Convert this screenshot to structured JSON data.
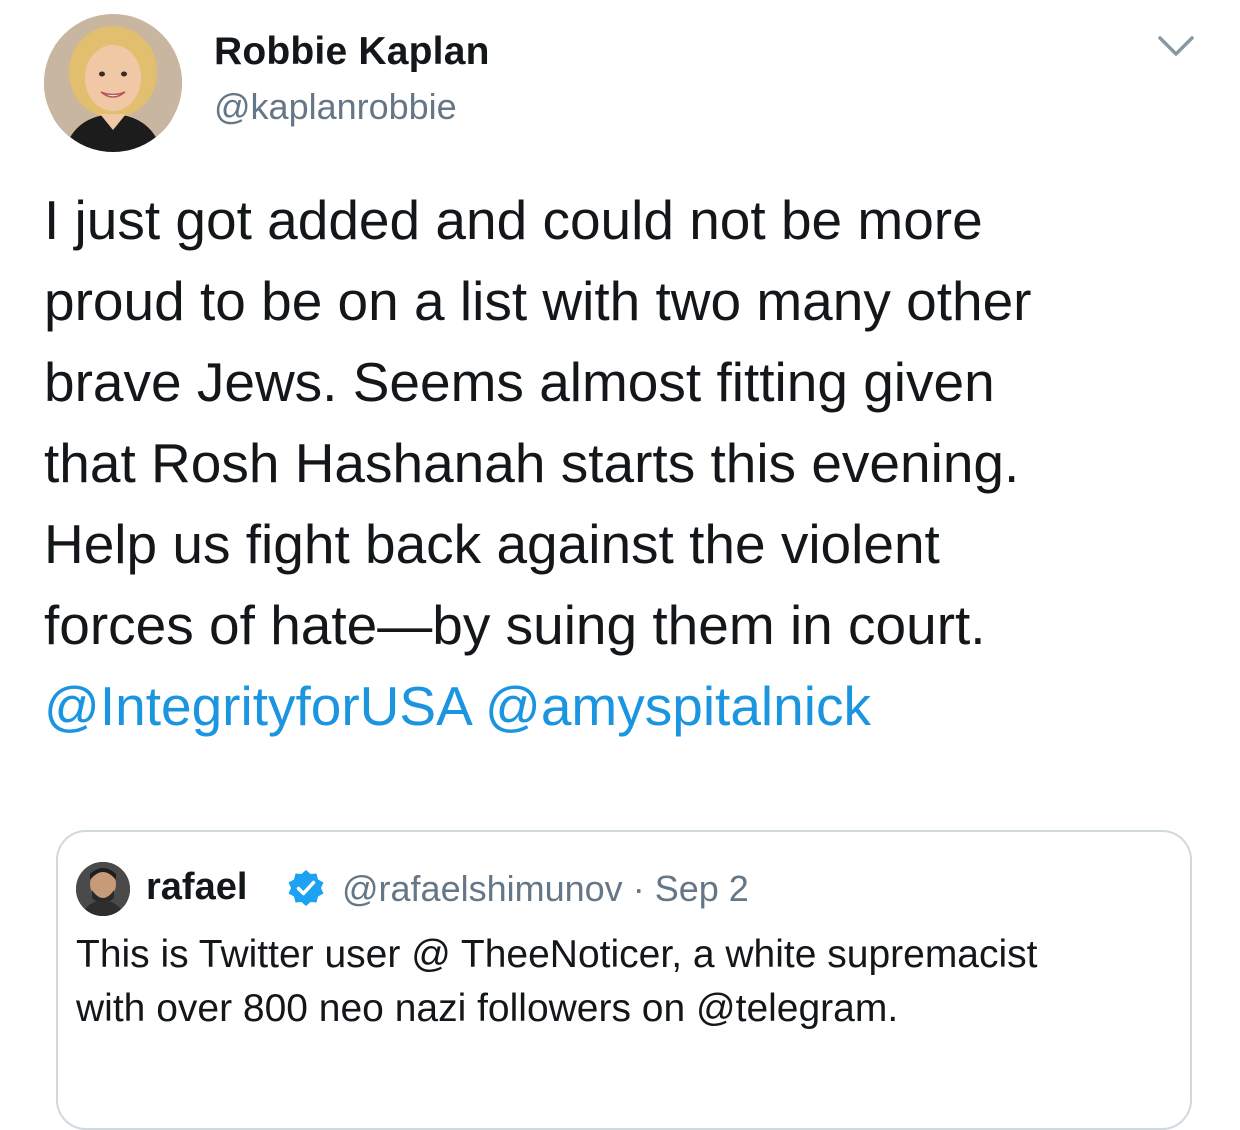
{
  "author": {
    "name": "Robbie Kaplan",
    "handle": "@kaplanrobbie",
    "avatar_icon": "profile-photo"
  },
  "menu_icon": "chevron-down-icon",
  "tweet": {
    "text": "I just got added and could not be more\nproud to be on a list with two many other\nbrave Jews. Seems almost fitting given\nthat Rosh Hashanah starts this evening.\nHelp us fight back against the violent\nforces of hate—by suing them in court.",
    "mentions": [
      "@IntegrityforUSA",
      "@amyspitalnick"
    ]
  },
  "quoted_tweet": {
    "name": "rafael",
    "verified_icon": "verified-badge-icon",
    "handle": "@rafaelshimunov",
    "separator": "·",
    "date": "Sep 2",
    "text": "This is Twitter user @ TheeNoticer, a white supremacist\nwith over 800 neo nazi followers on @telegram."
  },
  "colors": {
    "link": "#1b95e0",
    "secondary_text": "#657786",
    "verified": "#1da1f2",
    "border": "#cfd9de"
  }
}
